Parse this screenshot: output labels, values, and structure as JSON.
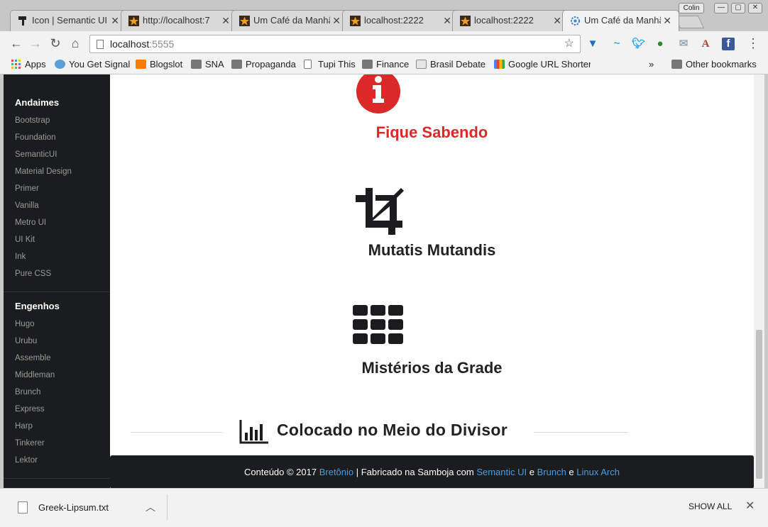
{
  "browser": {
    "profile": "Colin",
    "tabs": [
      {
        "title": "Icon | Semantic UI",
        "favicon": "paint-roller-icon",
        "active": false
      },
      {
        "title": "http://localhost:7",
        "favicon": "star-icon",
        "active": false
      },
      {
        "title": "Um Café da Manhã",
        "favicon": "star-icon",
        "active": false
      },
      {
        "title": "localhost:2222",
        "favicon": "star-icon",
        "active": false
      },
      {
        "title": "localhost:2222",
        "favicon": "star-icon",
        "active": false
      },
      {
        "title": "Um Café da Manhã",
        "favicon": "gear-icon",
        "active": true
      }
    ],
    "address": {
      "host": "localhost",
      "port": ":5555"
    },
    "bookmarks": [
      {
        "label": "Apps",
        "icon": "apps-grid-icon"
      },
      {
        "label": "You Get Signal",
        "icon": "globe-icon"
      },
      {
        "label": "Blogslot",
        "icon": "blogger-icon"
      },
      {
        "label": "SNA",
        "icon": "folder-icon"
      },
      {
        "label": "Propaganda",
        "icon": "folder-icon"
      },
      {
        "label": "Tupi This",
        "icon": "page-icon"
      },
      {
        "label": "Finance",
        "icon": "folder-icon"
      },
      {
        "label": "Brasil Debate",
        "icon": "brd-icon"
      },
      {
        "label": "Google URL Shortener",
        "icon": "google-icon"
      }
    ],
    "more_bookmarks": "»",
    "other_bookmarks": "Other bookmarks"
  },
  "sidebar": {
    "sections": [
      {
        "heading": "Andaimes",
        "items": [
          "Bootstrap",
          "Foundation",
          "SemanticUI",
          "Material Design",
          "Primer",
          "Vanilla",
          "Metro UI",
          "UI Kit",
          "Ink",
          "Pure CSS"
        ]
      },
      {
        "heading": "Engenhos",
        "items": [
          "Hugo",
          "Urubu",
          "Assemble",
          "Middleman",
          "Brunch",
          "Express",
          "Harp",
          "Tinkerer",
          "Lektor"
        ]
      }
    ]
  },
  "content": {
    "features": [
      {
        "title": "Fique Sabendo",
        "icon": "info-circle-icon"
      },
      {
        "title": "Mutatis Mutandis",
        "icon": "crop-icon"
      },
      {
        "title": "Mistérios da Grade",
        "icon": "grid-layout-icon"
      }
    ],
    "divider": {
      "text": "Colocado no Meio do Divisor",
      "icon": "bar-chart-icon"
    },
    "footer": {
      "prefix": "Conteúdo © 2017 ",
      "author": "Bretônio",
      "middle": " | Fabricado na Samboja com ",
      "link1": "Semantic UI",
      "and1": " e ",
      "link2": "Brunch",
      "and2": " e ",
      "link3": "Linux Arch"
    }
  },
  "downloads": {
    "file": "Greek-Lipsum.txt",
    "show_all": "SHOW ALL"
  },
  "colors": {
    "accent_red": "#db2828",
    "link_blue": "#4c9be0",
    "sidebar_bg": "#1b1c1d"
  }
}
